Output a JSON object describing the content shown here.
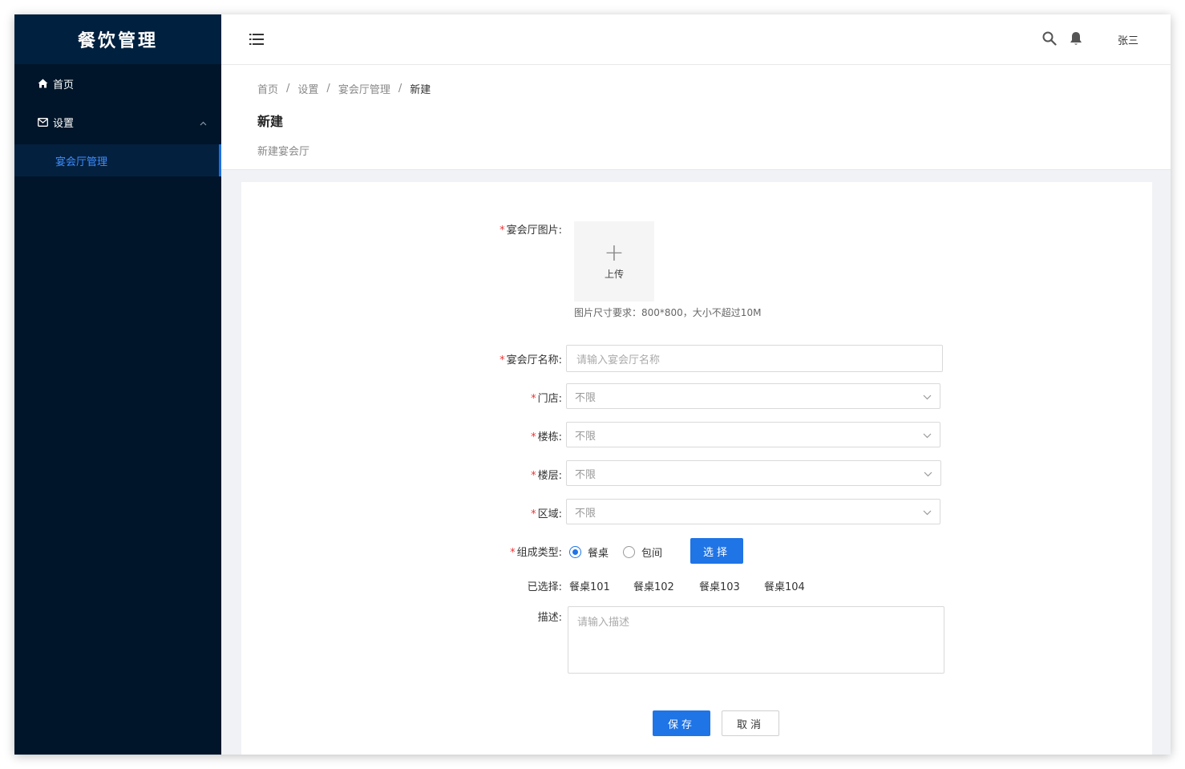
{
  "sidebar": {
    "logo": "餐饮管理",
    "items": [
      {
        "label": "首页",
        "icon": "home-icon"
      },
      {
        "label": "设置",
        "icon": "mail-icon"
      }
    ],
    "submenu_active": "宴会厅管理"
  },
  "topbar": {
    "user": "张三"
  },
  "breadcrumb": [
    "首页",
    "设置",
    "宴会厅管理",
    "新建"
  ],
  "page": {
    "title": "新建",
    "subtitle": "新建宴会厅"
  },
  "form": {
    "image_label": "宴会厅图片:",
    "upload_text": "上传",
    "upload_hint": "图片尺寸要求：800*800，大小不超过10M",
    "name_label": "宴会厅名称:",
    "name_placeholder": "请输入宴会厅名称",
    "store_label": "门店:",
    "store_value": "不限",
    "building_label": "楼栋:",
    "building_value": "不限",
    "floor_label": "楼层:",
    "floor_value": "不限",
    "area_label": "区域:",
    "area_value": "不限",
    "type_label": "组成类型:",
    "type_options": [
      "餐桌",
      "包间"
    ],
    "type_selected": "餐桌",
    "choose_button": "选择",
    "selected_label": "已选择:",
    "selected_items": [
      "餐桌101",
      "餐桌102",
      "餐桌103",
      "餐桌104"
    ],
    "desc_label": "描述:",
    "desc_placeholder": "请输入描述",
    "save_button": "保存",
    "cancel_button": "取消"
  },
  "colors": {
    "sidebar_bg": "#001529",
    "logo_bg": "#00203f",
    "primary": "#1f74e6",
    "required": "#e33333"
  }
}
